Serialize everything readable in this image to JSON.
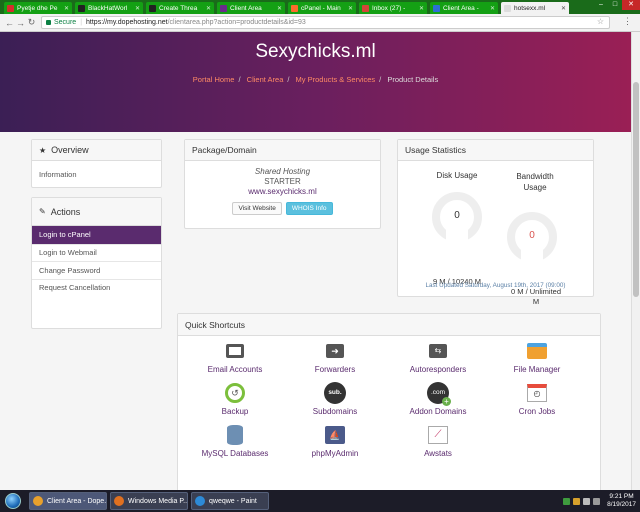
{
  "browser": {
    "tabs": [
      {
        "label": "Pyetje dhe Pe",
        "color": "#d62d2d"
      },
      {
        "label": "BlackHatWorl",
        "color": "#222222"
      },
      {
        "label": "Create Threa",
        "color": "#222222"
      },
      {
        "label": "Client Area",
        "color": "#6a2c8c"
      },
      {
        "label": "cPanel - Main",
        "color": "#ff6c2c"
      },
      {
        "label": "Inbox (27) -",
        "color": "#d44638"
      },
      {
        "label": "Client Area -",
        "color": "#2d6fd6"
      },
      {
        "label": "hotsexx.ml",
        "color": "#dddddd",
        "active": true
      }
    ],
    "secure_label": "Secure",
    "url_host": "https://my.dopehosting.net",
    "url_path": "/clientarea.php?action=productdetails&id=93"
  },
  "page": {
    "title": "Sexychicks.ml",
    "breadcrumbs": [
      "Portal Home",
      "Client Area",
      "My Products & Services"
    ],
    "breadcrumb_current": "Product Details"
  },
  "sidebar": {
    "overview": {
      "heading": "Overview",
      "items": [
        "Information"
      ]
    },
    "actions": {
      "heading": "Actions",
      "items": [
        "Login to cPanel",
        "Login to Webmail",
        "Change Password",
        "Request Cancellation"
      ]
    }
  },
  "package": {
    "heading": "Package/Domain",
    "group": "Shared Hosting",
    "plan": "STARTER",
    "domain": "www.sexychicks.ml",
    "visit_label": "Visit Website",
    "whois_label": "WHOIS Info"
  },
  "usage": {
    "heading": "Usage Statistics",
    "disk_label": "Disk Usage",
    "disk_value": "0",
    "disk_detail": "9 M / 10240 M",
    "bw_label_line1": "Bandwidth",
    "bw_label_line2": "Usage",
    "bw_value": "0",
    "bw_detail_line1": "0 M / Unlimited",
    "bw_detail_line2": "M",
    "last_updated": "Last Updated Saturday, August 19th, 2017 (09:00)"
  },
  "shortcuts": {
    "heading": "Quick Shortcuts",
    "items": [
      {
        "label": "Email Accounts",
        "icon": "email-icon"
      },
      {
        "label": "Forwarders",
        "icon": "forward-icon"
      },
      {
        "label": "Autoresponders",
        "icon": "autoresponder-icon"
      },
      {
        "label": "File Manager",
        "icon": "folder-icon"
      },
      {
        "label": "Backup",
        "icon": "backup-icon"
      },
      {
        "label": "Subdomains",
        "icon": "subdomain-icon"
      },
      {
        "label": "Addon Domains",
        "icon": "addon-domain-icon"
      },
      {
        "label": "Cron Jobs",
        "icon": "calendar-icon"
      },
      {
        "label": "MySQL Databases",
        "icon": "database-icon"
      },
      {
        "label": "phpMyAdmin",
        "icon": "phpmyadmin-icon"
      },
      {
        "label": "Awstats",
        "icon": "chart-icon"
      }
    ],
    "glyphs": {
      "subdomain": "sub.",
      "addon": ".com"
    }
  },
  "taskbar": {
    "tasks": [
      {
        "label": "Client Area - Dope...",
        "color": "#e8a02c",
        "active": true
      },
      {
        "label": "Windows Media P...",
        "color": "#e07020"
      },
      {
        "label": "qweqwe - Paint",
        "color": "#2d8ad6"
      }
    ],
    "time": "9:21 PM",
    "date": "8/19/2017"
  }
}
